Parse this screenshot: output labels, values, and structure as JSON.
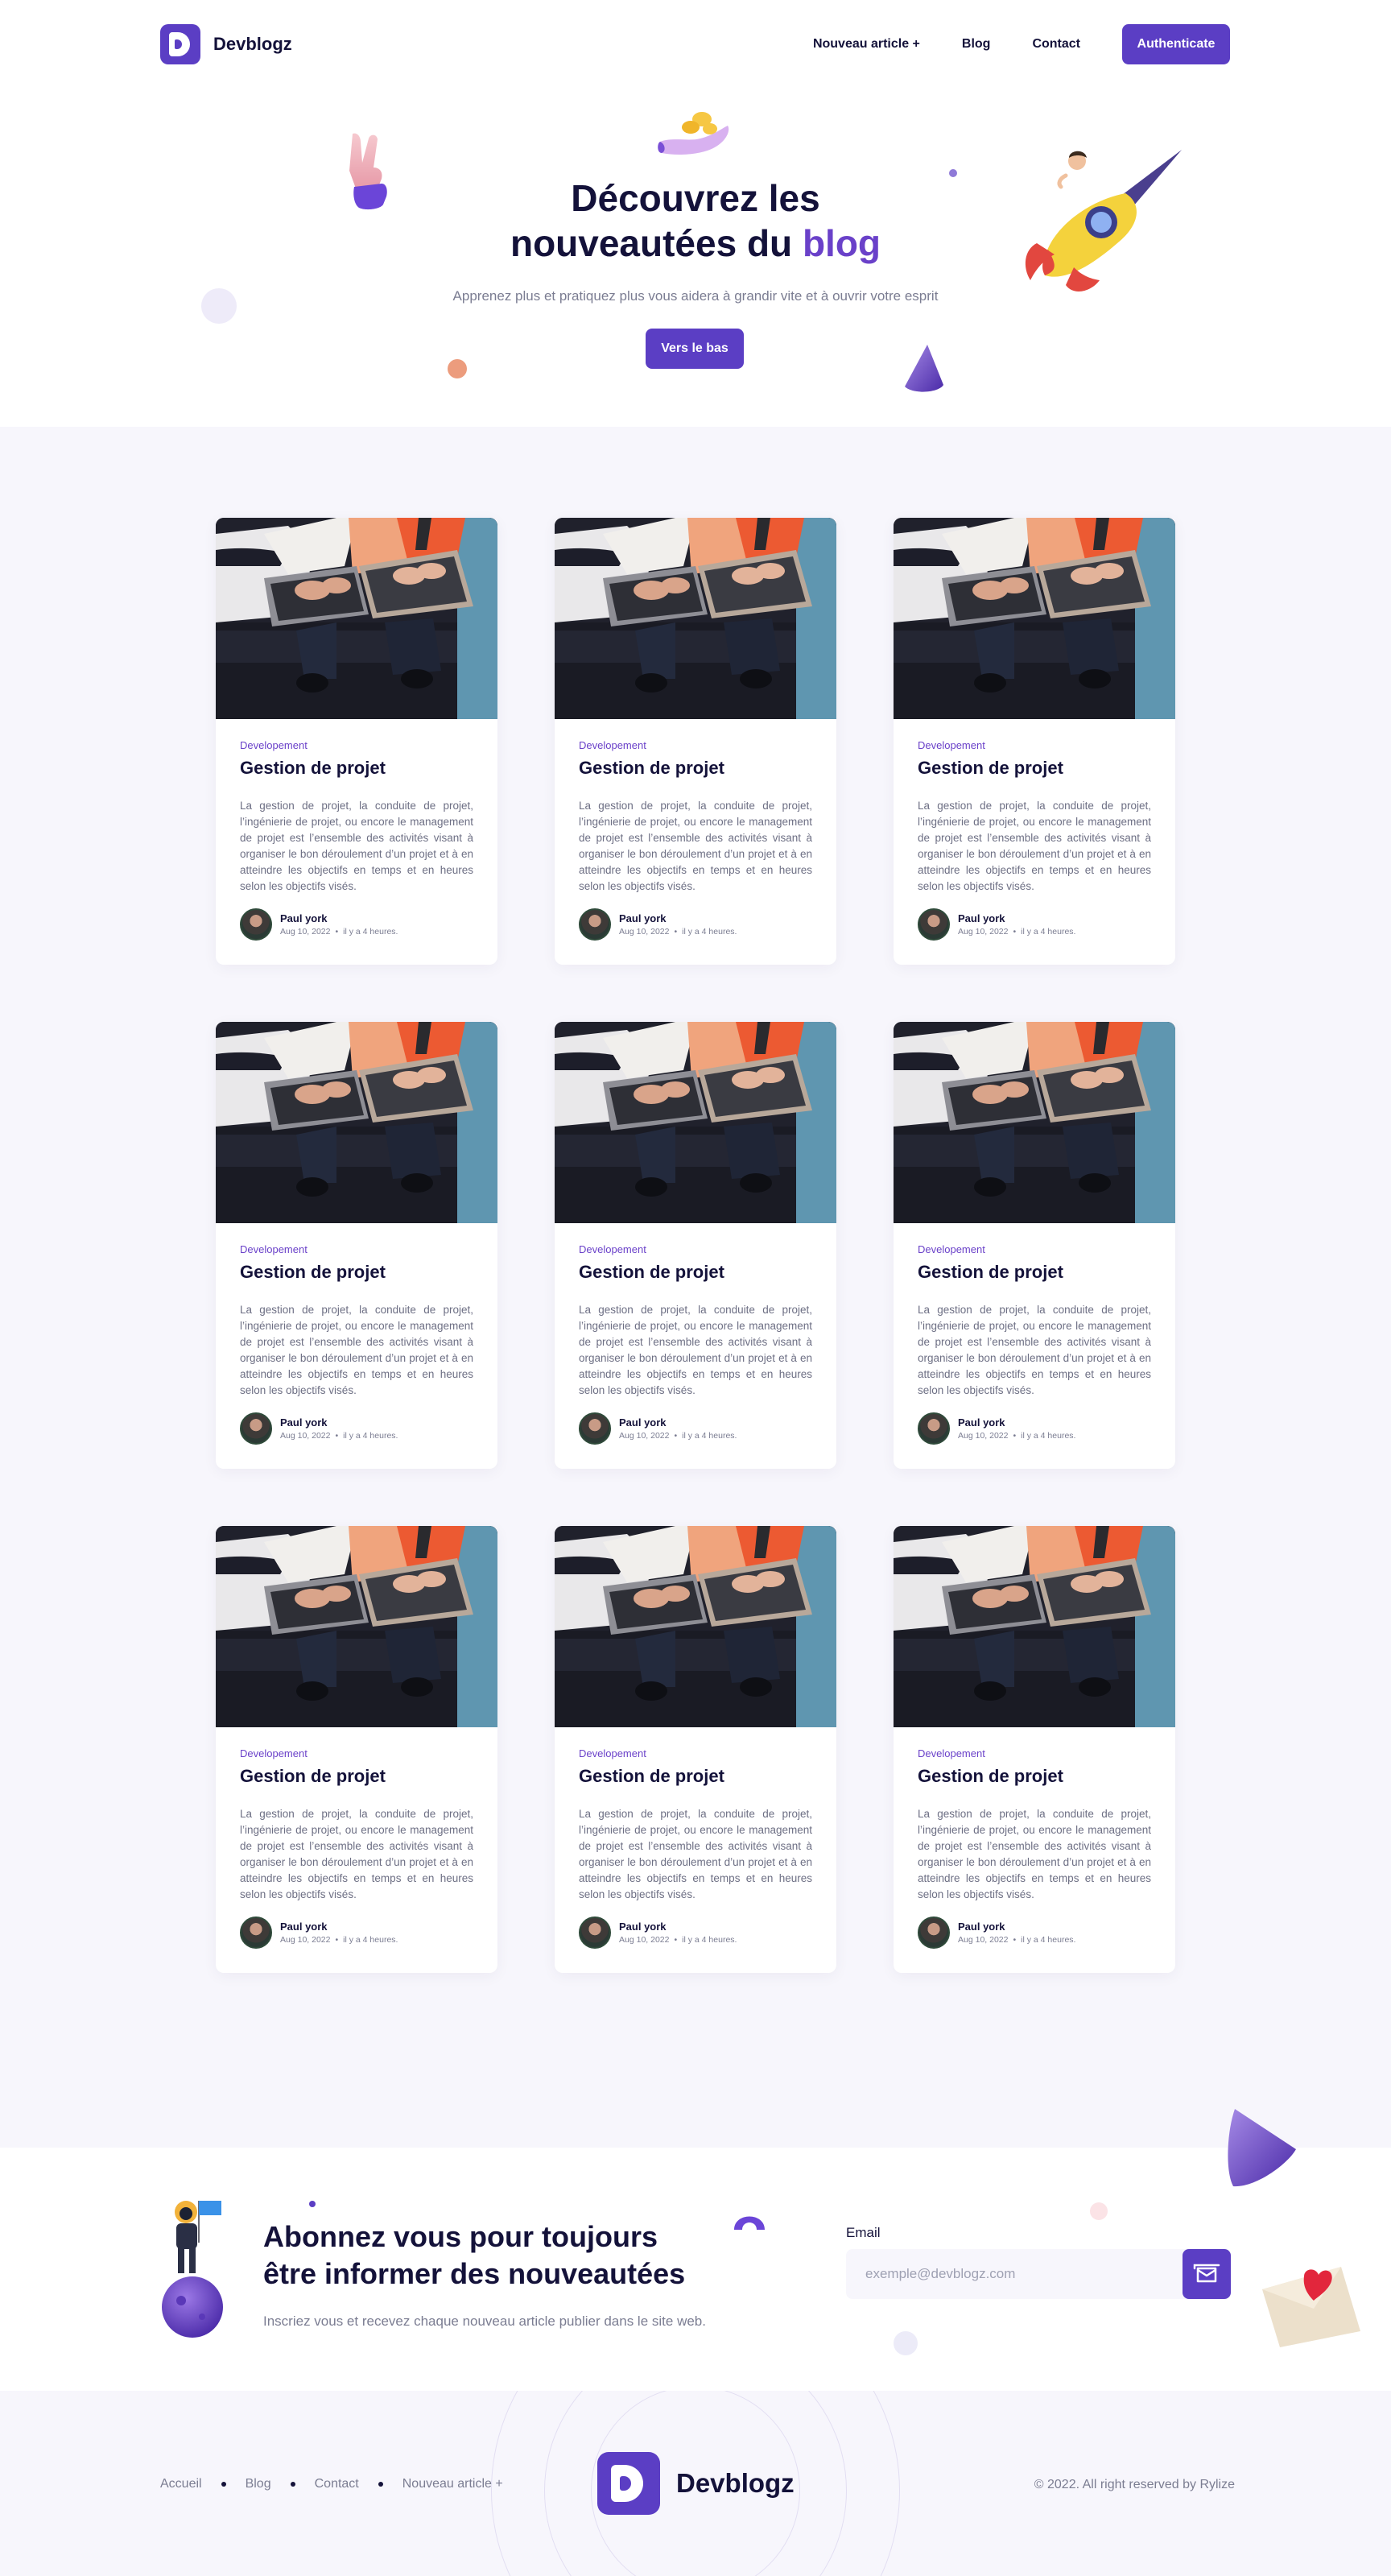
{
  "header": {
    "brand": "Devblogz",
    "nav": [
      "Nouveau article +",
      "Blog",
      "Contact"
    ],
    "auth_label": "Authenticate"
  },
  "hero": {
    "title_line1": "Découvrez les",
    "title_line2_prefix": "nouveautées du ",
    "title_accent": "blog",
    "subtitle": "Apprenez plus et pratiquez plus vous aidera à grandir vite et à ouvrir votre esprit",
    "cta": "Vers le bas"
  },
  "posts": [
    {
      "category": "Developement",
      "title": "Gestion de projet",
      "excerpt": "La gestion de projet, la conduite de projet, l’ingénierie de projet, ou encore le management de projet est l’ensemble des activités visant à organiser le bon déroulement d’un projet et à en atteindre les objectifs en temps et en heures selon les objectifs visés.",
      "author": "Paul york",
      "date": "Aug 10, 2022",
      "ago": "il y a 4 heures."
    },
    {
      "category": "Developement",
      "title": "Gestion de projet",
      "excerpt": "La gestion de projet, la conduite de projet, l’ingénierie de projet, ou encore le management de projet est l’ensemble des activités visant à organiser le bon déroulement d’un projet et à en atteindre les objectifs en temps et en heures selon les objectifs visés.",
      "author": "Paul york",
      "date": "Aug 10, 2022",
      "ago": "il y a 4 heures."
    },
    {
      "category": "Developement",
      "title": "Gestion de projet",
      "excerpt": "La gestion de projet, la conduite de projet, l’ingénierie de projet, ou encore le management de projet est l’ensemble des activités visant à organiser le bon déroulement d’un projet et à en atteindre les objectifs en temps et en heures selon les objectifs visés.",
      "author": "Paul york",
      "date": "Aug 10, 2022",
      "ago": "il y a 4 heures."
    },
    {
      "category": "Developement",
      "title": "Gestion de projet",
      "excerpt": "La gestion de projet, la conduite de projet, l’ingénierie de projet, ou encore le management de projet est l’ensemble des activités visant à organiser le bon déroulement d’un projet et à en atteindre les objectifs en temps et en heures selon les objectifs visés.",
      "author": "Paul york",
      "date": "Aug 10, 2022",
      "ago": "il y a 4 heures."
    },
    {
      "category": "Developement",
      "title": "Gestion de projet",
      "excerpt": "La gestion de projet, la conduite de projet, l’ingénierie de projet, ou encore le management de projet est l’ensemble des activités visant à organiser le bon déroulement d’un projet et à en atteindre les objectifs en temps et en heures selon les objectifs visés.",
      "author": "Paul york",
      "date": "Aug 10, 2022",
      "ago": "il y a 4 heures."
    },
    {
      "category": "Developement",
      "title": "Gestion de projet",
      "excerpt": "La gestion de projet, la conduite de projet, l’ingénierie de projet, ou encore le management de projet est l’ensemble des activités visant à organiser le bon déroulement d’un projet et à en atteindre les objectifs en temps et en heures selon les objectifs visés.",
      "author": "Paul york",
      "date": "Aug 10, 2022",
      "ago": "il y a 4 heures."
    },
    {
      "category": "Developement",
      "title": "Gestion de projet",
      "excerpt": "La gestion de projet, la conduite de projet, l’ingénierie de projet, ou encore le management de projet est l’ensemble des activités visant à organiser le bon déroulement d’un projet et à en atteindre les objectifs en temps et en heures selon les objectifs visés.",
      "author": "Paul york",
      "date": "Aug 10, 2022",
      "ago": "il y a 4 heures."
    },
    {
      "category": "Developement",
      "title": "Gestion de projet",
      "excerpt": "La gestion de projet, la conduite de projet, l’ingénierie de projet, ou encore le management de projet est l’ensemble des activités visant à organiser le bon déroulement d’un projet et à en atteindre les objectifs en temps et en heures selon les objectifs visés.",
      "author": "Paul york",
      "date": "Aug 10, 2022",
      "ago": "il y a 4 heures."
    },
    {
      "category": "Developement",
      "title": "Gestion de projet",
      "excerpt": "La gestion de projet, la conduite de projet, l’ingénierie de projet, ou encore le management de projet est l’ensemble des activités visant à organiser le bon déroulement d’un projet et à en atteindre les objectifs en temps et en heures selon les objectifs visés.",
      "author": "Paul york",
      "date": "Aug 10, 2022",
      "ago": "il y a 4 heures."
    }
  ],
  "newsletter": {
    "title_line1": "Abonnez vous pour toujours",
    "title_line2": "être informer des nouveautées",
    "subtitle": "Inscriez vous et recevez chaque nouveau article publier dans le site web.",
    "email_label": "Email",
    "email_placeholder": "exemple@devblogz.com",
    "email_value": ""
  },
  "footer": {
    "links": [
      "Accueil",
      "Blog",
      "Contact",
      "Nouveau article +"
    ],
    "brand": "Devblogz",
    "copyright": "© 2022. All right reserved by Rylize"
  },
  "colors": {
    "primary": "#5b3ec4",
    "accent_text": "#6a41c9",
    "heading": "#14123a",
    "muted": "#7b7d92",
    "section_bg": "#f7f6fc"
  },
  "icons": [
    "logo-mark-icon",
    "peace-hand-icon",
    "coins-hand-icon",
    "rocket-rider-icon",
    "cone-icon",
    "astronaut-icon",
    "heart-envelope-icon",
    "mail-send-icon"
  ]
}
